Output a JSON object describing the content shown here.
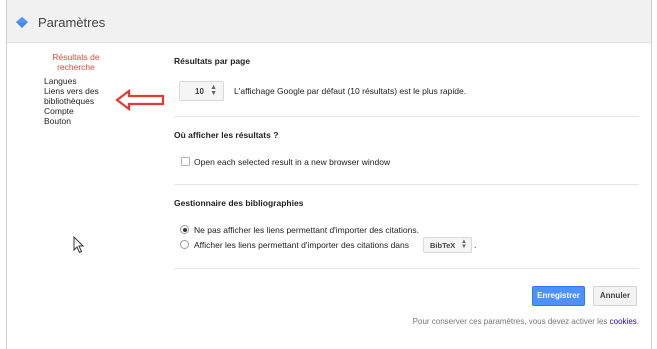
{
  "header": {
    "title": "Paramètres",
    "logo_icon": "blue-diamond-icon"
  },
  "sidebar": {
    "items": [
      {
        "label": "Résultats de recherche",
        "active": true
      },
      {
        "label": "Langues"
      },
      {
        "label": "Liens vers des bibliothèques"
      },
      {
        "label": "Compte"
      },
      {
        "label": "Bouton"
      }
    ]
  },
  "annotation": {
    "arrow_color": "#e53935"
  },
  "results_per_page": {
    "title": "Résultats par page",
    "value": "10",
    "description": "L'affichage Google par défaut (10 résultats) est le plus rapide."
  },
  "where": {
    "title": "Où afficher les résultats ?",
    "checkbox_label": "Open each selected result in a new browser window",
    "checked": false
  },
  "bibliography": {
    "title": "Gestionnaire des bibliographies",
    "option_none": "Ne pas afficher les liens permettant d'importer des citations.",
    "option_show": "Afficher les liens permettant d'importer des citations dans",
    "format": "BibTeX",
    "trailing": ".",
    "selected": "none"
  },
  "actions": {
    "save": "Enregistrer",
    "cancel": "Annuler"
  },
  "footer": {
    "note": "Pour conserver ces paramètres, vous devez activer les",
    "link": "cookies",
    "end": "."
  },
  "colors": {
    "accent": "#4d90fe",
    "active_nav": "#dd4b39"
  }
}
